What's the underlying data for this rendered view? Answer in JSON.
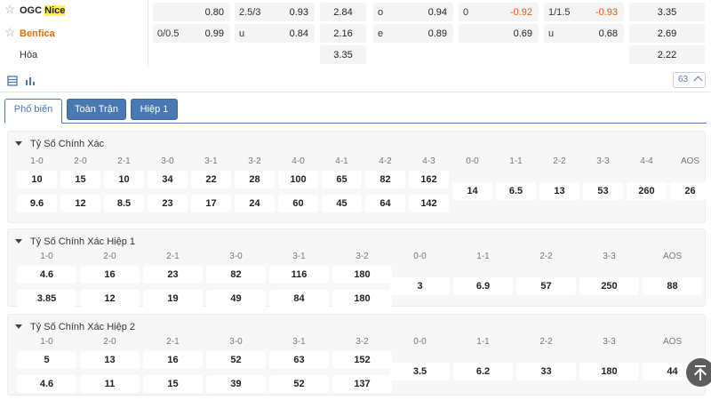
{
  "teams": {
    "home": {
      "name_prefix": "OGC",
      "name_highlight": "Nice"
    },
    "away": {
      "name": "Benfica"
    },
    "draw": {
      "name": "Hòa"
    }
  },
  "odds": {
    "home": [
      "",
      "0.80",
      "2.5/3",
      "0.93",
      "2.84",
      "o",
      "0.94",
      "0",
      "-0.92",
      "1/1.5",
      "-0.93",
      "3.35"
    ],
    "away": [
      "0/0.5",
      "0.99",
      "u",
      "0.84",
      "2.16",
      "e",
      "0.89",
      "",
      "0.69",
      "u",
      "0.68",
      "2.69"
    ],
    "draw": {
      "x12": "3.35",
      "x12_h1": "2.22"
    }
  },
  "toolbar": {
    "count": "63"
  },
  "tabs": {
    "popular": "Phổ biến",
    "full_match": "Toàn Trận",
    "half1": "Hiệp 1"
  },
  "sections": [
    {
      "title": "Tỷ Số Chính Xác",
      "left_labels": [
        "1-0",
        "2-0",
        "2-1",
        "3-0",
        "3-1",
        "3-2",
        "4-0",
        "4-1",
        "4-2",
        "4-3"
      ],
      "left_row1": [
        "10",
        "15",
        "10",
        "34",
        "22",
        "28",
        "100",
        "65",
        "82",
        "162"
      ],
      "left_row2": [
        "9.6",
        "12",
        "8.5",
        "23",
        "17",
        "24",
        "60",
        "45",
        "64",
        "142"
      ],
      "right_labels": [
        "0-0",
        "1-1",
        "2-2",
        "3-3",
        "4-4",
        "AOS"
      ],
      "right_values": [
        "14",
        "6.5",
        "13",
        "53",
        "260",
        "26"
      ]
    },
    {
      "title": "Tỷ Số Chính Xác Hiệp 1",
      "left_labels": [
        "1-0",
        "2-0",
        "2-1",
        "3-0",
        "3-1",
        "3-2"
      ],
      "left_row1": [
        "4.6",
        "16",
        "23",
        "82",
        "116",
        "180"
      ],
      "left_row2": [
        "3.85",
        "12",
        "19",
        "49",
        "84",
        "180"
      ],
      "right_labels": [
        "0-0",
        "1-1",
        "2-2",
        "3-3",
        "AOS"
      ],
      "right_values": [
        "3",
        "6.9",
        "57",
        "250",
        "88"
      ]
    },
    {
      "title": "Tỷ Số Chính Xác Hiệp 2",
      "left_labels": [
        "1-0",
        "2-0",
        "2-1",
        "3-0",
        "3-1",
        "3-2"
      ],
      "left_row1": [
        "5",
        "13",
        "16",
        "52",
        "63",
        "152"
      ],
      "left_row2": [
        "4.6",
        "11",
        "15",
        "39",
        "52",
        "137"
      ],
      "right_labels": [
        "0-0",
        "1-1",
        "2-2",
        "3-3",
        "AOS"
      ],
      "right_values": [
        "3.5",
        "6.2",
        "33",
        "180",
        "44"
      ]
    }
  ],
  "colors": {
    "accent": "#4a78b3",
    "negative": "#e05a00",
    "team_away": "#e07000"
  }
}
